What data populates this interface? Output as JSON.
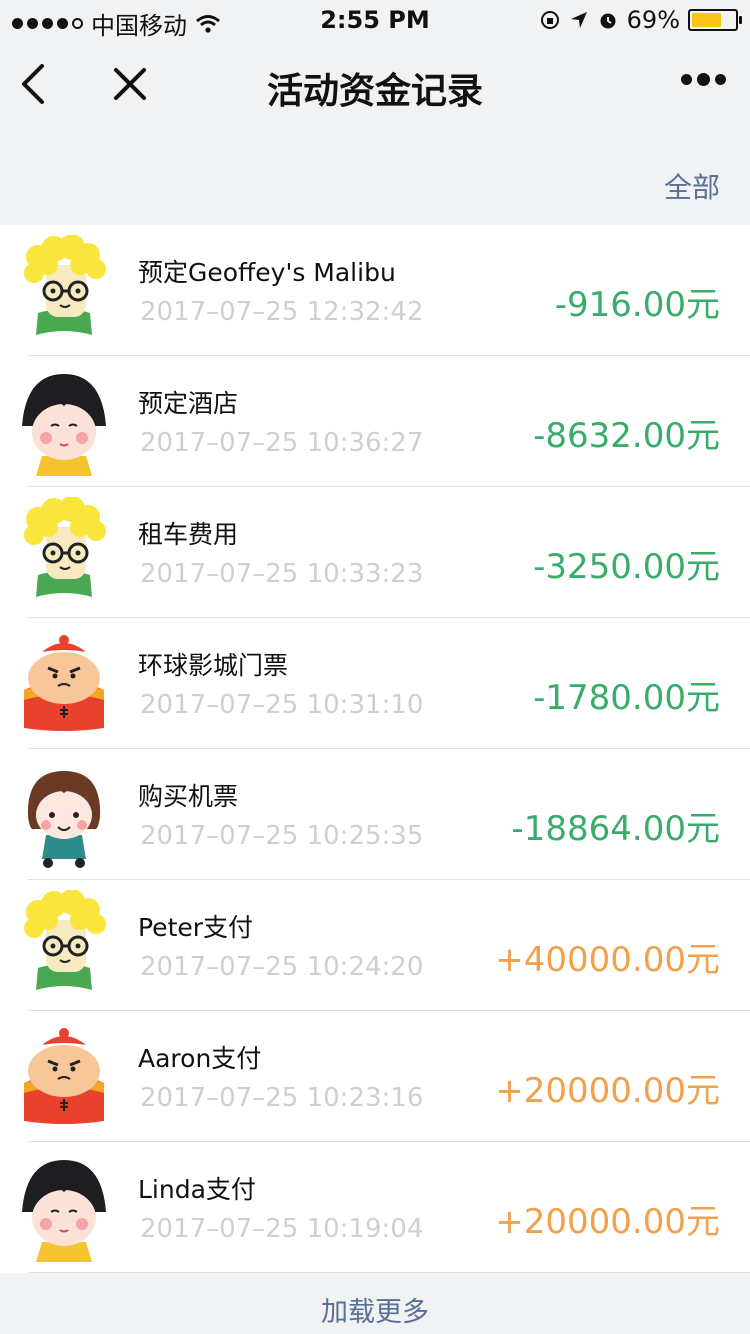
{
  "status_bar": {
    "carrier": "中国移动",
    "time": "2:55 PM",
    "battery": "69%",
    "battery_level": 0.69
  },
  "nav": {
    "title": "活动资金记录"
  },
  "filter": {
    "label": "全部"
  },
  "records": [
    {
      "avatar": "curly-hair-glasses-boy",
      "title": "预定Geoffey's Malibu",
      "time": "2017–07–25 12:32:42",
      "amount": "-916.00元",
      "type": "expense"
    },
    {
      "avatar": "bob-hair-girl",
      "title": "预定酒店",
      "time": "2017–07–25 10:36:27",
      "amount": "-8632.00元",
      "type": "expense"
    },
    {
      "avatar": "curly-hair-glasses-boy",
      "title": "租车费用",
      "time": "2017–07–25 10:33:23",
      "amount": "-3250.00元",
      "type": "expense"
    },
    {
      "avatar": "red-hat-chubby-man",
      "title": "环球影城门票",
      "time": "2017–07–25 10:31:10",
      "amount": "-1780.00元",
      "type": "expense"
    },
    {
      "avatar": "brown-hair-girl",
      "title": "购买机票",
      "time": "2017–07–25 10:25:35",
      "amount": "-18864.00元",
      "type": "expense"
    },
    {
      "avatar": "curly-hair-glasses-boy",
      "title": "Peter支付",
      "time": "2017–07–25 10:24:20",
      "amount": "+40000.00元",
      "type": "income"
    },
    {
      "avatar": "red-hat-chubby-man",
      "title": "Aaron支付",
      "time": "2017–07–25 10:23:16",
      "amount": "+20000.00元",
      "type": "income"
    },
    {
      "avatar": "bob-hair-girl",
      "title": "Linda支付",
      "time": "2017–07–25 10:19:04",
      "amount": "+20000.00元",
      "type": "income"
    }
  ],
  "load_more": {
    "label": "加载更多"
  }
}
